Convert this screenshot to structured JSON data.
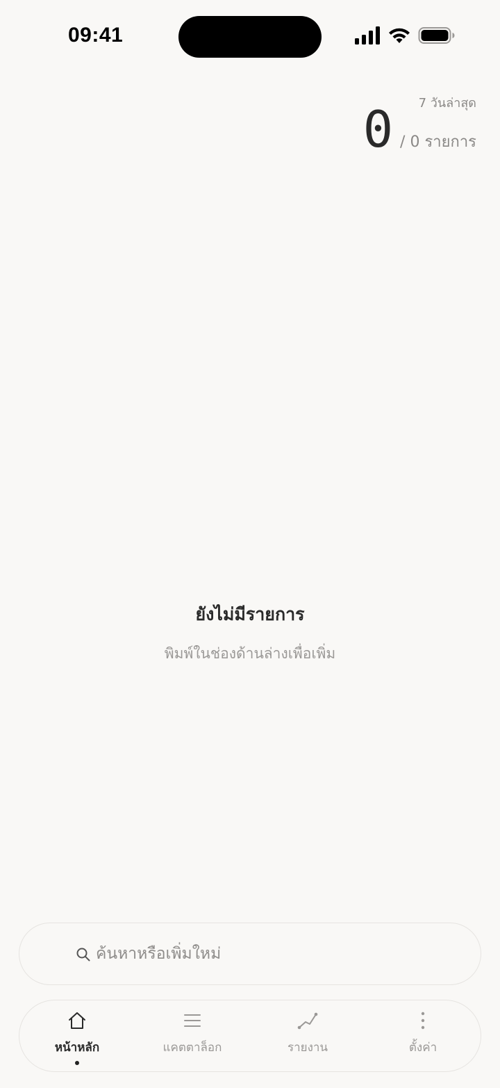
{
  "status_bar": {
    "time": "09:41"
  },
  "header": {
    "range_label": "7 วันล่าสุด",
    "count": "0",
    "total": "/ 0 รายการ"
  },
  "empty_state": {
    "title": "ยังไม่มีรายการ",
    "subtitle": "พิมพ์ในช่องด้านล่างเพื่อเพิ่ม"
  },
  "search": {
    "placeholder": "ค้นหาหรือเพิ่มใหม่",
    "value": ""
  },
  "tabs": [
    {
      "label": "หน้าหลัก",
      "icon": "home-icon",
      "active": true
    },
    {
      "label": "แคตตาล็อก",
      "icon": "list-icon",
      "active": false
    },
    {
      "label": "รายงาน",
      "icon": "chart-line-icon",
      "active": false
    },
    {
      "label": "ตั้งค่า",
      "icon": "more-vertical-icon",
      "active": false
    }
  ],
  "colors": {
    "background": "#f9f8f6",
    "muted_text": "#9a9896",
    "border": "#e6e4e1"
  }
}
